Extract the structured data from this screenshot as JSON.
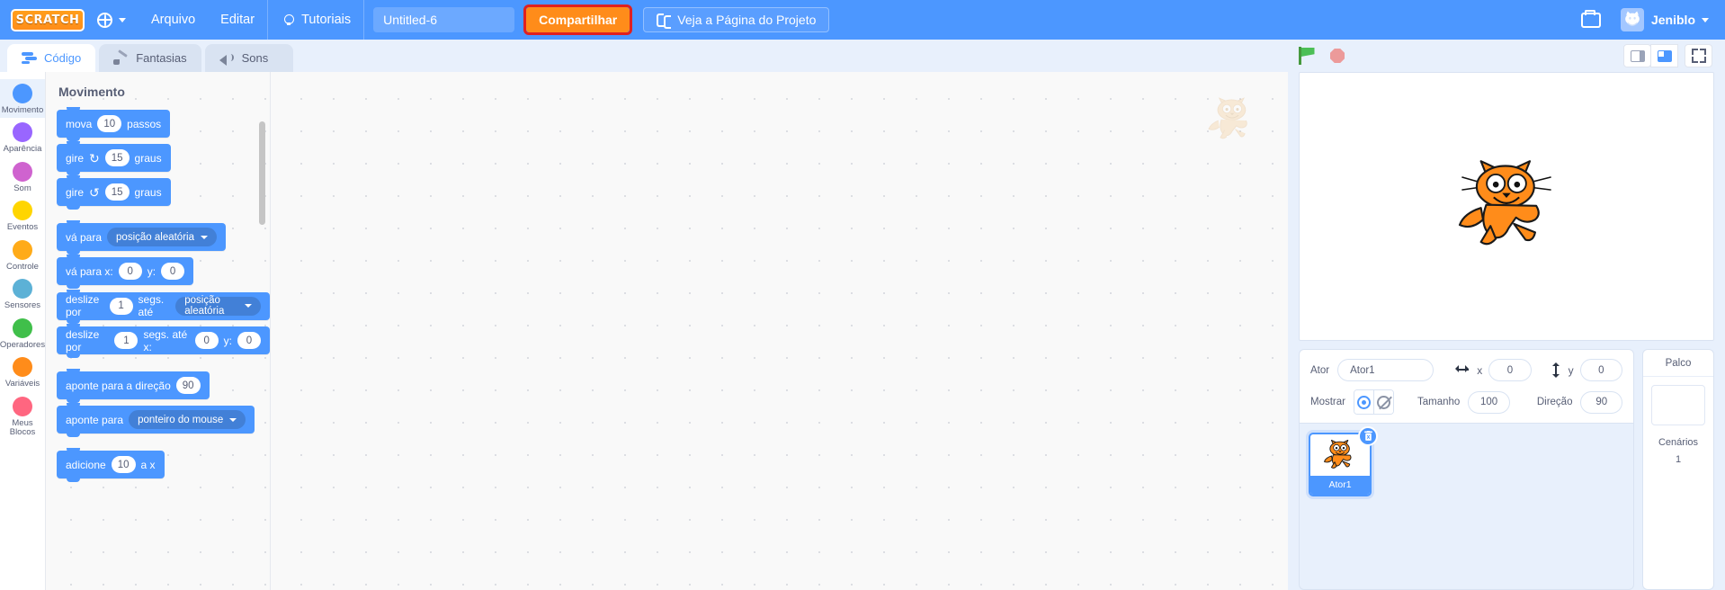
{
  "menubar": {
    "logo_text": "SCRATCH",
    "language_icon": "globe-icon",
    "items": [
      {
        "label": "Arquivo",
        "name": "menu-arquivo"
      },
      {
        "label": "Editar",
        "name": "menu-editar"
      }
    ],
    "tutorials_label": "Tutoriais",
    "project_title_value": "Untitled-6",
    "project_title_placeholder": "Nome do projeto",
    "share_label": "Compartilhar",
    "project_page_label": "Veja a Página do Projeto",
    "folder_icon": "folder-icon",
    "account_name": "Jeniblo",
    "accent_orange": "#ff8c1a",
    "highlight_red": "#e02020",
    "brand_blue": "#4c97ff"
  },
  "tabs": [
    {
      "label": "Código",
      "icon": "code-icon",
      "active": true
    },
    {
      "label": "Fantasias",
      "icon": "brush-icon",
      "active": false
    },
    {
      "label": "Sons",
      "icon": "speaker-icon",
      "active": false
    }
  ],
  "categories": [
    {
      "label": "Movimento",
      "color": "#4c97ff",
      "selected": true
    },
    {
      "label": "Aparência",
      "color": "#9966ff",
      "selected": false
    },
    {
      "label": "Som",
      "color": "#cf63cf",
      "selected": false
    },
    {
      "label": "Eventos",
      "color": "#ffd500",
      "selected": false
    },
    {
      "label": "Controle",
      "color": "#ffab19",
      "selected": false
    },
    {
      "label": "Sensores",
      "color": "#5cb1d6",
      "selected": false
    },
    {
      "label": "Operadores",
      "color": "#40bf4a",
      "selected": false
    },
    {
      "label": "Variáveis",
      "color": "#ff8c1a",
      "selected": false
    },
    {
      "label": "Meus Blocos",
      "color": "#ff6680",
      "selected": false
    }
  ],
  "palette": {
    "heading": "Movimento",
    "blocks": [
      {
        "type": "simple",
        "parts": [
          {
            "t": "text",
            "v": "mova"
          },
          {
            "t": "oval",
            "v": "10"
          },
          {
            "t": "text",
            "v": "passos"
          }
        ]
      },
      {
        "type": "simple",
        "parts": [
          {
            "t": "text",
            "v": "gire"
          },
          {
            "t": "rot",
            "v": "↻"
          },
          {
            "t": "oval",
            "v": "15"
          },
          {
            "t": "text",
            "v": "graus"
          }
        ]
      },
      {
        "type": "simple",
        "parts": [
          {
            "t": "text",
            "v": "gire"
          },
          {
            "t": "rot",
            "v": "↺"
          },
          {
            "t": "oval",
            "v": "15"
          },
          {
            "t": "text",
            "v": "graus"
          }
        ]
      },
      {
        "type": "gap"
      },
      {
        "type": "simple",
        "parts": [
          {
            "t": "text",
            "v": "vá para"
          },
          {
            "t": "drop",
            "v": "posição aleatória"
          }
        ]
      },
      {
        "type": "simple",
        "parts": [
          {
            "t": "text",
            "v": "vá para x:"
          },
          {
            "t": "oval",
            "v": "0"
          },
          {
            "t": "text",
            "v": "y:"
          },
          {
            "t": "oval",
            "v": "0"
          }
        ]
      },
      {
        "type": "simple",
        "parts": [
          {
            "t": "text",
            "v": "deslize por"
          },
          {
            "t": "oval",
            "v": "1"
          },
          {
            "t": "text",
            "v": "segs. até"
          },
          {
            "t": "drop",
            "v": "posição aleatória"
          }
        ]
      },
      {
        "type": "simple",
        "parts": [
          {
            "t": "text",
            "v": "deslize por"
          },
          {
            "t": "oval",
            "v": "1"
          },
          {
            "t": "text",
            "v": "segs. até x:"
          },
          {
            "t": "oval",
            "v": "0"
          },
          {
            "t": "text",
            "v": "y:"
          },
          {
            "t": "oval",
            "v": "0"
          }
        ]
      },
      {
        "type": "gap"
      },
      {
        "type": "simple",
        "parts": [
          {
            "t": "text",
            "v": "aponte  para a direção"
          },
          {
            "t": "oval",
            "v": "90"
          }
        ]
      },
      {
        "type": "simple",
        "parts": [
          {
            "t": "text",
            "v": "aponte para"
          },
          {
            "t": "drop",
            "v": "ponteiro do mouse"
          }
        ]
      },
      {
        "type": "gap"
      },
      {
        "type": "simple",
        "parts": [
          {
            "t": "text",
            "v": "adicione"
          },
          {
            "t": "oval",
            "v": "10"
          },
          {
            "t": "text",
            "v": "a x"
          }
        ]
      }
    ]
  },
  "stage_controls": {
    "green_flag": "green-flag-icon",
    "stop": "stop-icon",
    "small_stage": "small-stage-icon",
    "large_stage": "large-stage-icon",
    "fullscreen": "fullscreen-icon"
  },
  "sprite_info": {
    "sprite_label": "Ator",
    "sprite_name": "Ator1",
    "x_label": "x",
    "x_value": "0",
    "y_label": "y",
    "y_value": "0",
    "show_label": "Mostrar",
    "size_label": "Tamanho",
    "size_value": "100",
    "direction_label": "Direção",
    "direction_value": "90"
  },
  "sprite_list": [
    {
      "name": "Ator1",
      "selected": true
    }
  ],
  "stage_selector": {
    "title": "Palco",
    "backdrops_label": "Cenários",
    "backdrops_count": "1"
  }
}
